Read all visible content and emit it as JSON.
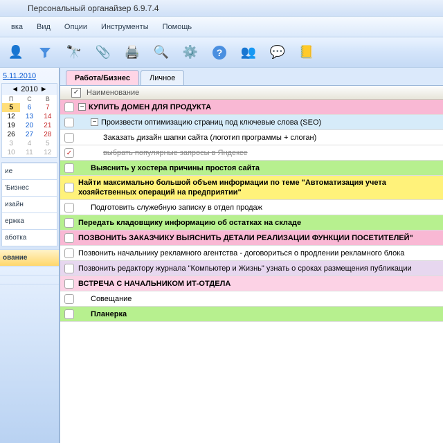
{
  "title": "Персональный органайзер 6.9.7.4",
  "menu": {
    "items": [
      "вка",
      "Вид",
      "Опции",
      "Инструменты",
      "Помощь"
    ]
  },
  "toolbar": {
    "icons": [
      "person-icon",
      "funnel-icon",
      "binoculars-icon",
      "attachment-icon",
      "print-icon",
      "preview-icon",
      "settings-icon",
      "help-icon",
      "users-icon",
      "chat-icon",
      "notes-icon"
    ]
  },
  "sidebar": {
    "current_date": "5.11.2010",
    "calendar": {
      "month": "2010",
      "dow": [
        "П",
        "С",
        "В"
      ],
      "weeks": [
        [
          {
            "d": "5",
            "cls": "today"
          },
          {
            "d": "6",
            "cls": "sat"
          },
          {
            "d": "7",
            "cls": "sun"
          }
        ],
        [
          {
            "d": "12",
            "cls": ""
          },
          {
            "d": "13",
            "cls": "sat"
          },
          {
            "d": "14",
            "cls": "sun"
          }
        ],
        [
          {
            "d": "19",
            "cls": ""
          },
          {
            "d": "20",
            "cls": "sat"
          },
          {
            "d": "21",
            "cls": "sun"
          }
        ],
        [
          {
            "d": "26",
            "cls": ""
          },
          {
            "d": "27",
            "cls": "sat"
          },
          {
            "d": "28",
            "cls": "sun"
          }
        ],
        [
          {
            "d": "3",
            "cls": "gray"
          },
          {
            "d": "4",
            "cls": "gray"
          },
          {
            "d": "5",
            "cls": "gray"
          }
        ],
        [
          {
            "d": "10",
            "cls": "gray"
          },
          {
            "d": "11",
            "cls": "gray"
          },
          {
            "d": "12",
            "cls": "gray"
          }
        ]
      ]
    },
    "groups": [
      "ие",
      "'Бизнес",
      "изайн",
      "ержка",
      "аботка"
    ],
    "panes": [
      "ование",
      "",
      "",
      ""
    ]
  },
  "tabs": [
    {
      "label": "Работа/Бизнес",
      "active": true
    },
    {
      "label": "Личное",
      "active": false
    }
  ],
  "list_header": {
    "checkbox": "✓",
    "title": "Наименование"
  },
  "tasks": [
    {
      "bg": "pink",
      "bold": true,
      "indent": 0,
      "exp": "−",
      "chk": "",
      "text": "КУПИТЬ ДОМЕН ДЛЯ ПРОДУКТА"
    },
    {
      "bg": "blue",
      "bold": false,
      "indent": 1,
      "exp": "−",
      "chk": "",
      "text": "Произвести оптимизацию страниц под ключевые слова (SEO)"
    },
    {
      "bg": "white",
      "bold": false,
      "indent": 2,
      "exp": "",
      "chk": "",
      "text": "Заказать дизайн шапки сайта (логотип программы + слоган)"
    },
    {
      "bg": "white",
      "bold": false,
      "indent": 2,
      "exp": "",
      "chk": "✓",
      "text": "выбрать популярные запросы в Яндексе",
      "strike": true
    },
    {
      "bg": "green",
      "bold": true,
      "indent": 1,
      "exp": "",
      "chk": "",
      "text": "Выяснить у хостера причины простоя сайта"
    },
    {
      "bg": "yellow",
      "bold": true,
      "indent": 0,
      "exp": "",
      "chk": "",
      "text": "Найти максимально большой объем информации по теме \"Автоматизация учета хозяйственных операций на предприятии\""
    },
    {
      "bg": "white",
      "bold": false,
      "indent": 1,
      "exp": "",
      "chk": "",
      "text": "Подготовить служебную записку в отдел продаж"
    },
    {
      "bg": "green",
      "bold": true,
      "indent": 0,
      "exp": "",
      "chk": "",
      "text": "Передать кладовщику информацию об остатках на складе"
    },
    {
      "bg": "pink",
      "bold": true,
      "indent": 0,
      "exp": "",
      "chk": "",
      "text": "ПОЗВОНИТЬ ЗАКАЗЧИКУ ВЫЯСНИТЬ ДЕТАЛИ РЕАЛИЗАЦИИ ФУНКЦИИ ПОСЕТИТЕЛЕЙ\""
    },
    {
      "bg": "white",
      "bold": false,
      "indent": 0,
      "exp": "",
      "chk": "",
      "text": "Позвонить начальнику рекламного агентства - договориться о продлении рекламного блока"
    },
    {
      "bg": "lav",
      "bold": false,
      "indent": 0,
      "exp": "",
      "chk": "",
      "text": "Позвонить редактору журнала \"Компьютер и Жизнь\" узнать о сроках размещения публикации"
    },
    {
      "bg": "pink2",
      "bold": true,
      "indent": 0,
      "exp": "",
      "chk": "",
      "text": "ВСТРЕЧА С НАЧАЛЬНИКОМ ИТ-ОТДЕЛА"
    },
    {
      "bg": "white",
      "bold": false,
      "indent": 1,
      "exp": "",
      "chk": "",
      "text": "Совещание"
    },
    {
      "bg": "green",
      "bold": true,
      "indent": 1,
      "exp": "",
      "chk": "",
      "text": "Планерка"
    }
  ]
}
